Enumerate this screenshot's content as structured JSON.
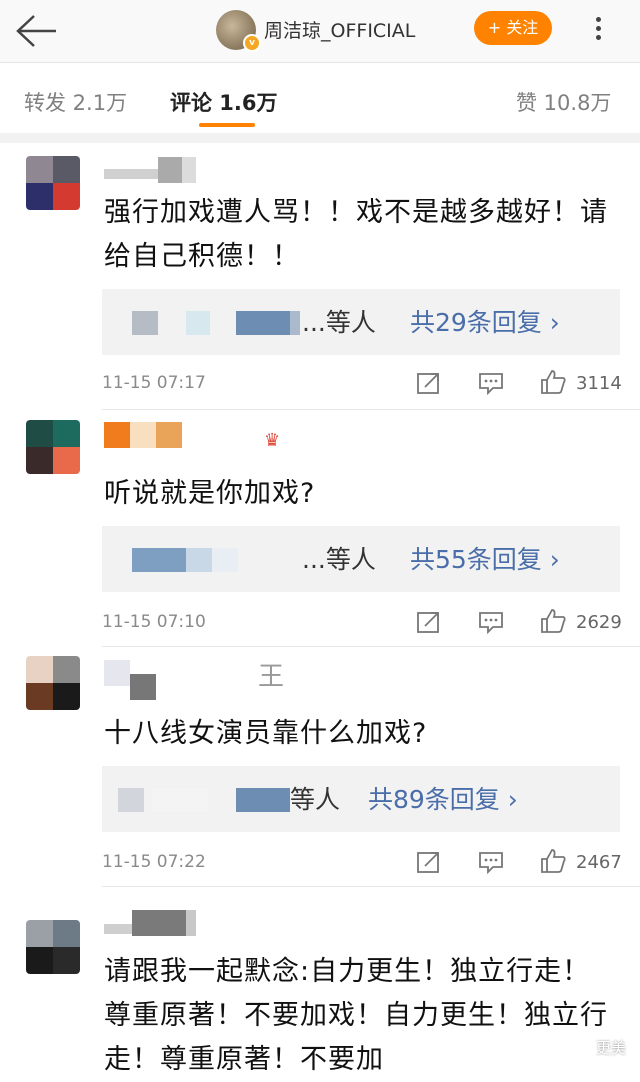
{
  "header": {
    "username": "周洁琼_OFFICIAL",
    "verified_badge": "v",
    "follow_label": "+ 关注",
    "icons": [
      "back-arrow-icon",
      "more-dots-icon"
    ]
  },
  "tabs": [
    {
      "label": "转发 2.1万",
      "active": false
    },
    {
      "label": "评论 1.6万",
      "active": true
    },
    {
      "label": "赞 10.8万",
      "active": false
    }
  ],
  "comments": [
    {
      "name_visible": "",
      "text": "强行加戏遭人骂！！戏不是越多越好！请给自己积德！！",
      "reply_suffix": "...等人",
      "reply_link": "共29条回复 ›",
      "time": "11-15 07:17",
      "likes": "3114"
    },
    {
      "name_visible": "",
      "text": "听说就是你加戏?",
      "reply_suffix": "...等人",
      "reply_link": "共55条回复 ›",
      "time": "11-15 07:10",
      "likes": "2629"
    },
    {
      "name_visible": "王",
      "text": "十八线女演员靠什么加戏?",
      "reply_suffix": "等人",
      "reply_link": "共89条回复 ›",
      "time": "11-15 07:22",
      "likes": "2467"
    },
    {
      "name_visible": "",
      "text": "请跟我一起默念:自力更生！独立行走！尊重原著！不要加戏！自力更生！独立行走！尊重原著！不要加",
      "time": "",
      "likes": ""
    }
  ],
  "action_icons": [
    "share-icon",
    "comment-icon",
    "like-icon"
  ],
  "watermark": "更美",
  "colors": {
    "accent": "#ff8200",
    "link": "#4a6ea9",
    "reply_bg": "#f2f2f2"
  }
}
